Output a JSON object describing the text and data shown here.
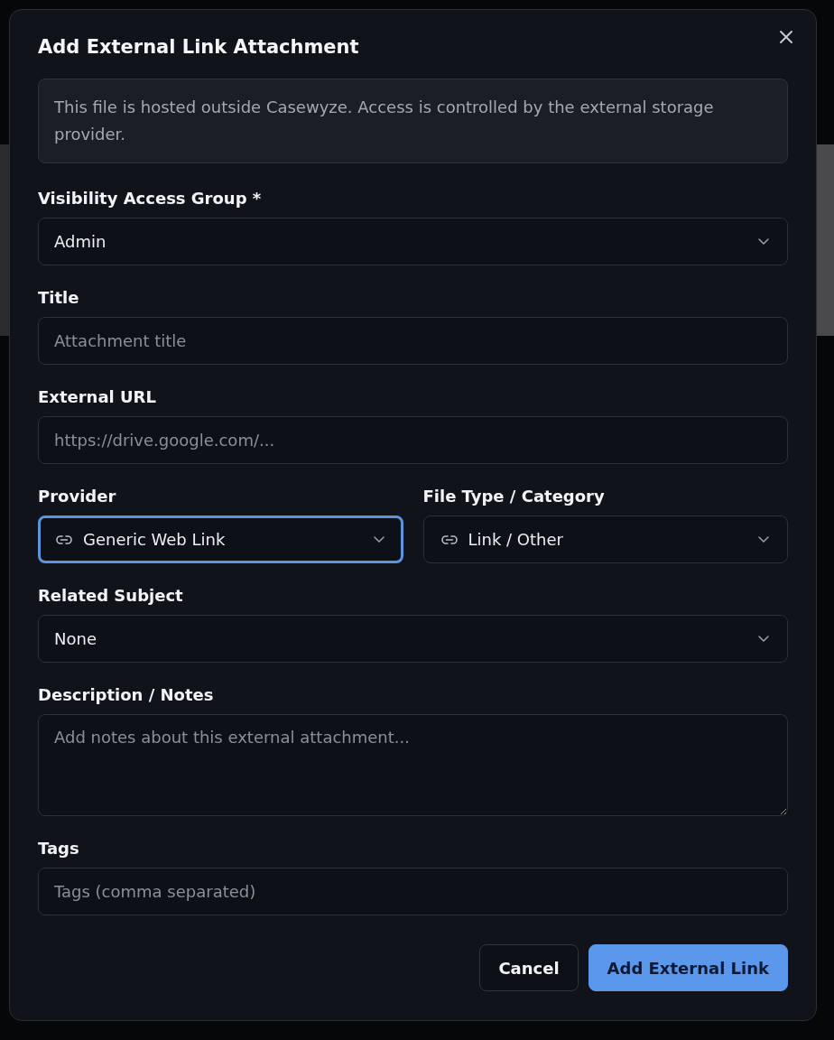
{
  "dialog": {
    "title": "Add External Link Attachment"
  },
  "notice": "This file is hosted outside Casewyze. Access is controlled by the external storage provider.",
  "rows": [
    {
      "fields": [
        {
          "kind": "select",
          "label": "Visibility Access Group *",
          "value": "Admin",
          "focused": false
        }
      ]
    },
    {
      "fields": [
        {
          "kind": "text",
          "label": "Title",
          "placeholder": "Attachment title",
          "focused": false
        }
      ]
    },
    {
      "fields": [
        {
          "kind": "text",
          "label": "External URL",
          "placeholder": "https://drive.google.com/...",
          "focused": false
        }
      ]
    },
    {
      "fields": [
        {
          "kind": "icon_select",
          "label": "Provider",
          "value": "Generic Web Link",
          "focused": true
        },
        {
          "kind": "icon_select",
          "label": "File Type / Category",
          "value": "Link / Other",
          "focused": false
        }
      ]
    },
    {
      "fields": [
        {
          "kind": "select",
          "label": "Related Subject",
          "value": "None",
          "focused": false
        }
      ]
    },
    {
      "fields": [
        {
          "kind": "textarea",
          "label": "Description / Notes",
          "placeholder": "Add notes about this external attachment...",
          "focused": false
        }
      ]
    },
    {
      "fields": [
        {
          "kind": "text",
          "label": "Tags",
          "placeholder": "Tags (comma separated)",
          "focused": false
        }
      ]
    }
  ],
  "buttons": [
    {
      "kind": "secondary",
      "label": "Cancel"
    },
    {
      "kind": "primary",
      "label": "Add External Link"
    }
  ]
}
